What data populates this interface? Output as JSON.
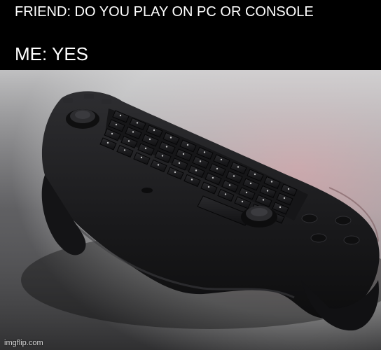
{
  "meme": {
    "top_text": "FRIEND: DO YOU PLAY ON PC OR CONSOLE",
    "bottom_text": "ME: YES"
  },
  "photo": {
    "subject": "keyboard-controller-hybrid",
    "colors": {
      "background_light": "#d8d8d8",
      "background_pink": "#c98f95",
      "controller_body": "#1b1b1d",
      "key_label": "#e6e6e6"
    }
  },
  "watermark": {
    "text": "imgflip.com"
  }
}
